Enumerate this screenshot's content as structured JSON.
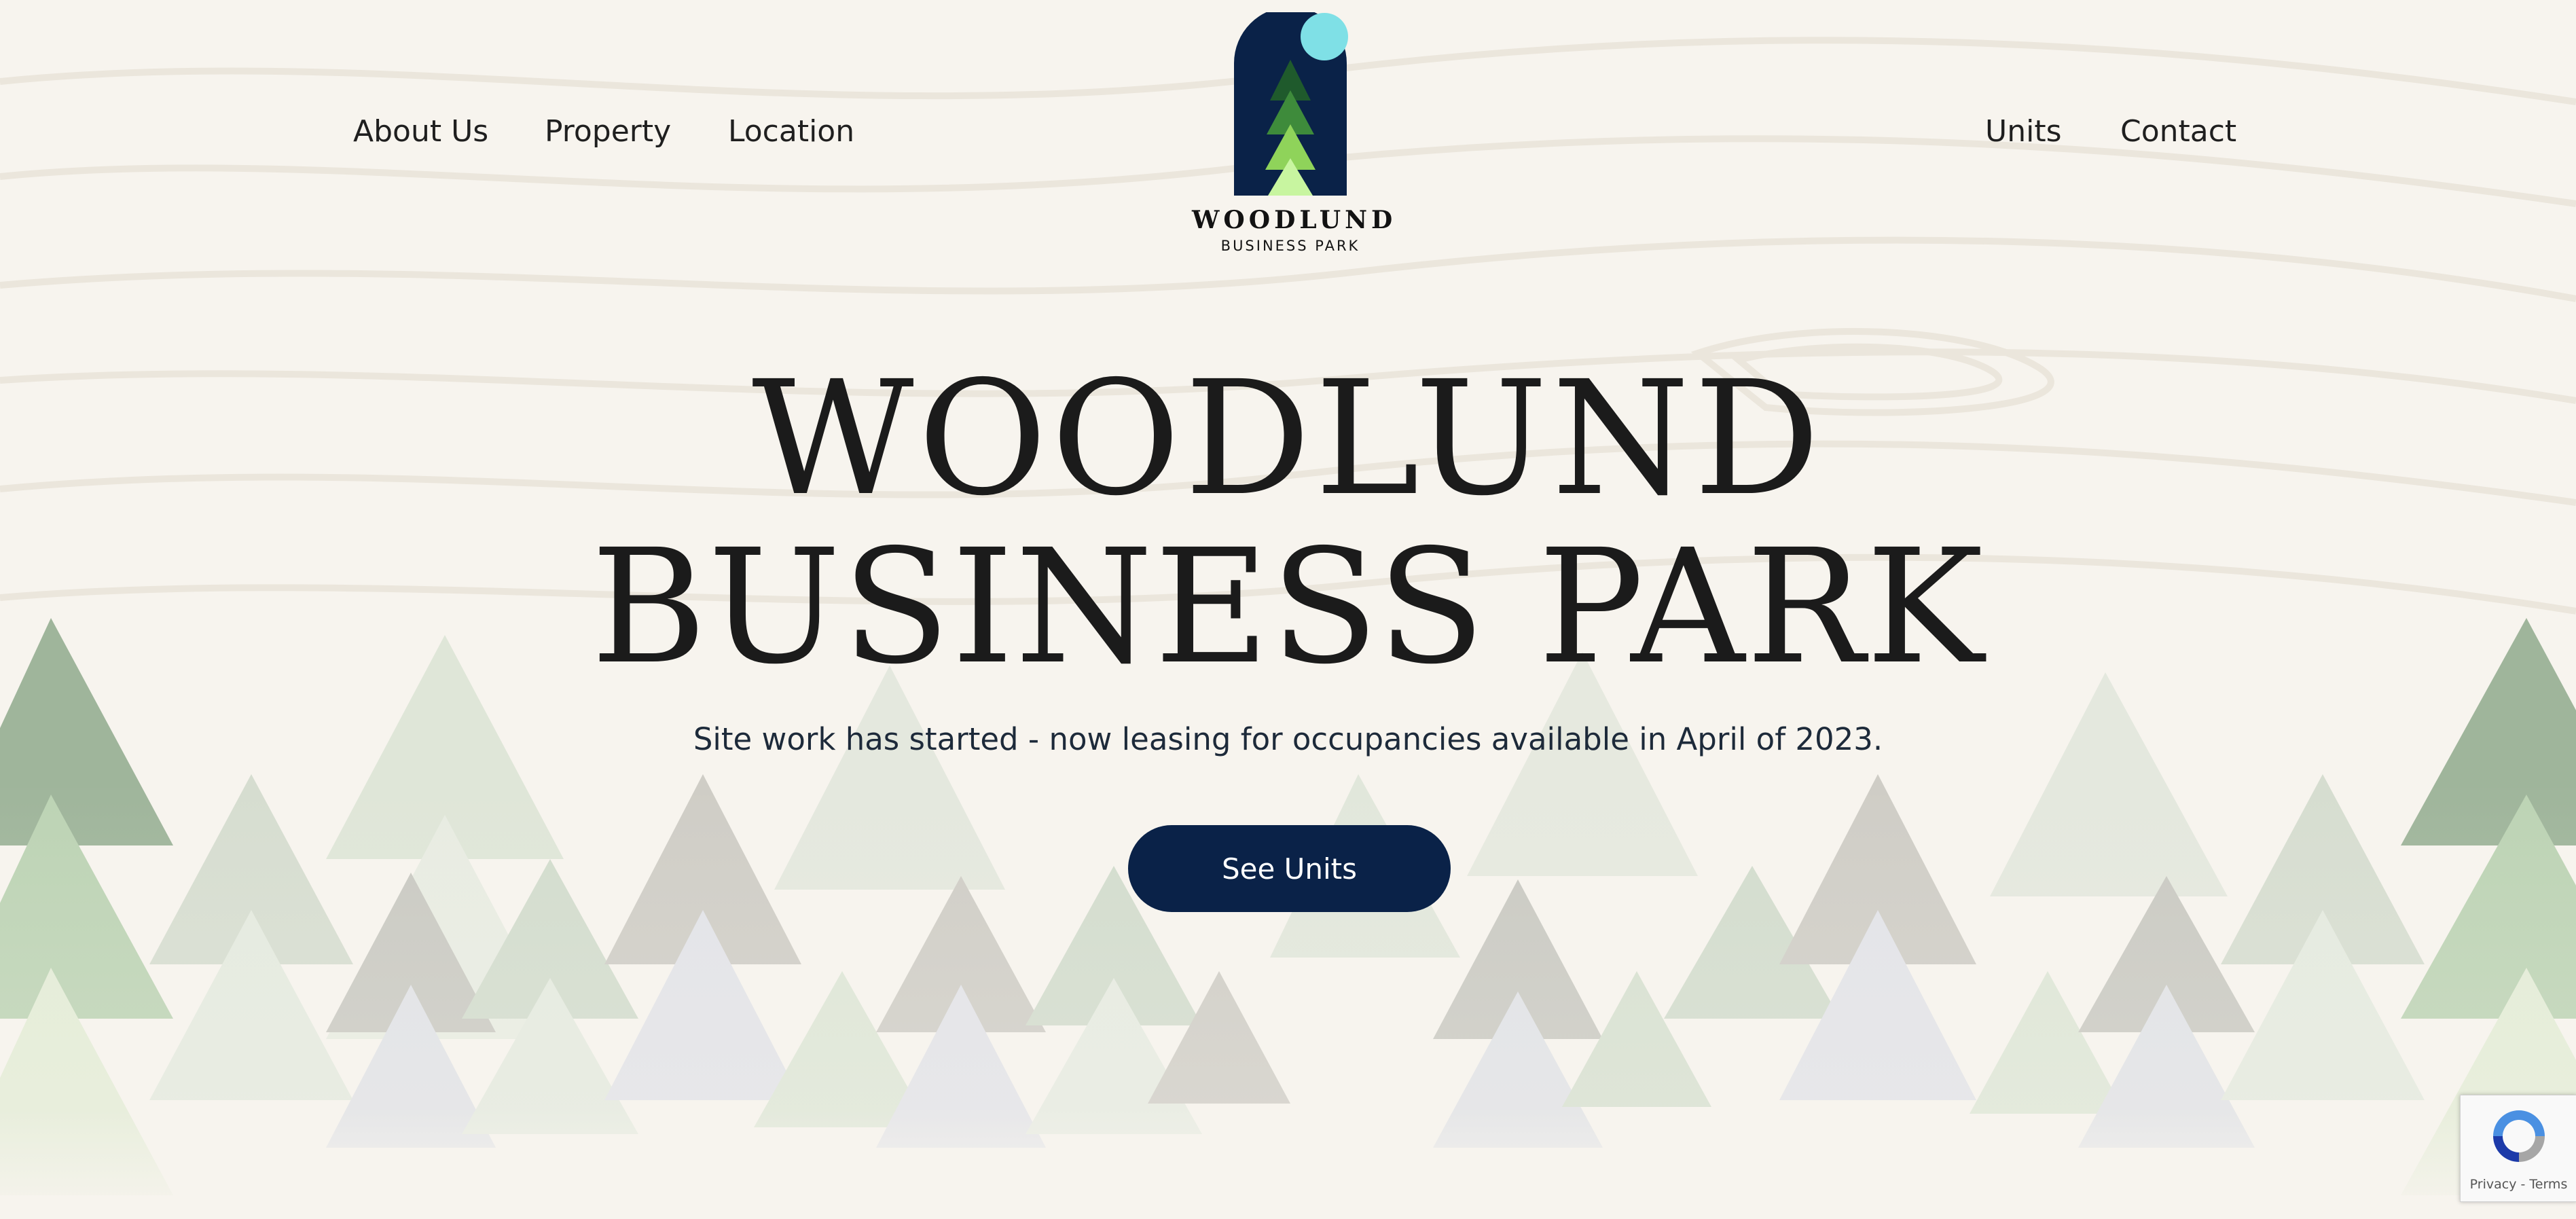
{
  "nav": {
    "left": [
      {
        "label": "About Us"
      },
      {
        "label": "Property"
      },
      {
        "label": "Location"
      }
    ],
    "right": [
      {
        "label": "Units"
      },
      {
        "label": "Contact"
      }
    ]
  },
  "logo": {
    "name": "WOODLUND",
    "sub": "BUSINESS PARK",
    "icon": "tree-arch-logo-icon"
  },
  "hero": {
    "title_line1": "WOODLUND",
    "title_line2": "BUSINESS PARK",
    "subtitle": "Site work has started - now leasing for occupancies available in April of 2023.",
    "cta_label": "See Units"
  },
  "recaptcha": {
    "privacy": "Privacy",
    "separator": " - ",
    "terms": "Terms",
    "icon": "recaptcha-icon"
  },
  "colors": {
    "background": "#f7f4ee",
    "navy": "#0a2248",
    "accent_cyan": "#7fe0e6",
    "tree_dark": "#1f5a2c",
    "tree_mid": "#3e8b3b",
    "tree_light": "#8fd35a",
    "tree_pale": "#c8f5a0"
  }
}
